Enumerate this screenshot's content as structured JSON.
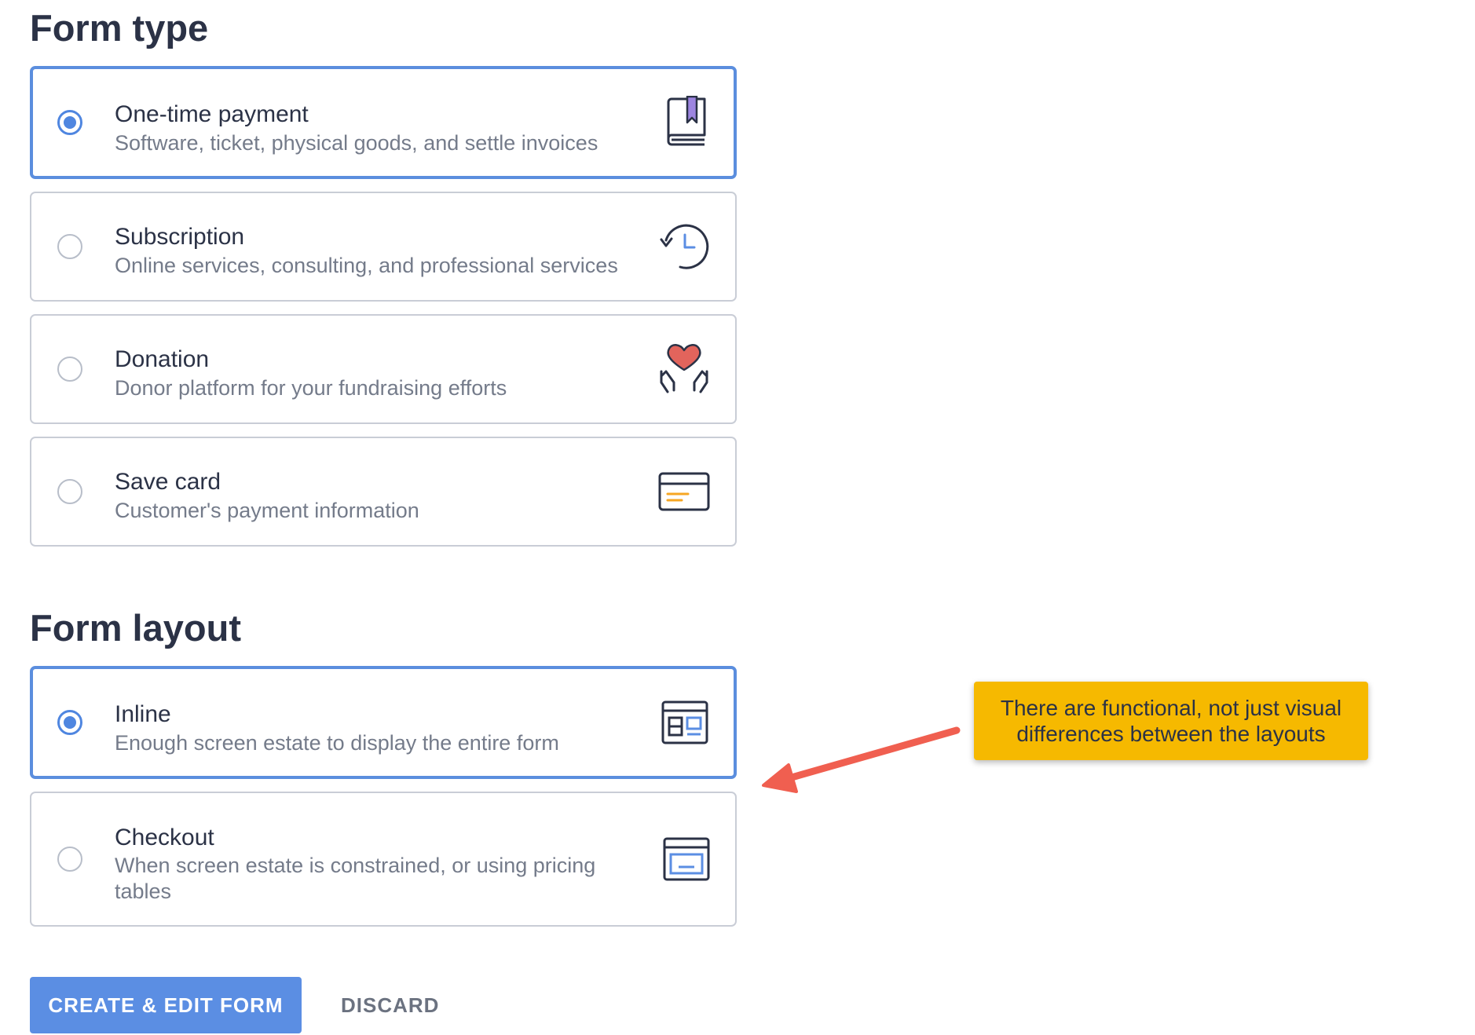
{
  "form_type": {
    "title": "Form type",
    "options": [
      {
        "title": "One-time payment",
        "description": "Software, ticket, physical goods, and settle invoices",
        "icon": "book-icon",
        "selected": true
      },
      {
        "title": "Subscription",
        "description": "Online services, consulting, and professional services",
        "icon": "recurring-clock-icon",
        "selected": false
      },
      {
        "title": "Donation",
        "description": "Donor platform for your fundraising efforts",
        "icon": "heart-hands-icon",
        "selected": false
      },
      {
        "title": "Save card",
        "description": "Customer's payment information",
        "icon": "credit-card-icon",
        "selected": false
      }
    ]
  },
  "form_layout": {
    "title": "Form layout",
    "options": [
      {
        "title": "Inline",
        "description": "Enough screen estate to display the entire form",
        "icon": "inline-layout-icon",
        "selected": true
      },
      {
        "title": "Checkout",
        "description": "When screen estate is constrained, or using pricing tables",
        "icon": "checkout-layout-icon",
        "selected": false
      }
    ]
  },
  "actions": {
    "primary_label": "CREATE & EDIT FORM",
    "secondary_label": "DISCARD"
  },
  "annotation": {
    "line1": "There are functional, not just visual",
    "line2": "differences between the layouts"
  },
  "colors": {
    "accent": "#5b8ee3",
    "selected_border": "#5b8ede",
    "callout": "#f6b900",
    "arrow": "#f05f50",
    "heart": "#e2645c",
    "bookmark": "#9d85e0"
  }
}
